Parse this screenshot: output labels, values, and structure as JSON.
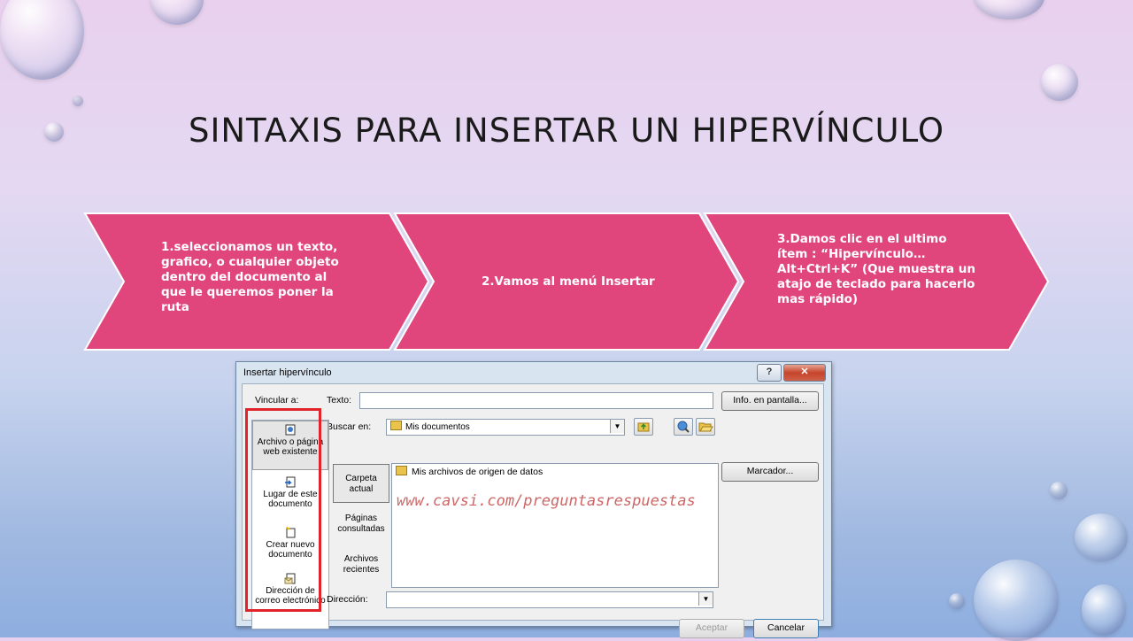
{
  "slide": {
    "title": "SINTAXIS PARA INSERTAR UN HIPERVÍNCULO"
  },
  "steps": [
    {
      "text": "1.seleccionamos un texto, grafico, o cualquier objeto dentro del documento al que le queremos poner la ruta"
    },
    {
      "text": "2.Vamos al menú Insertar"
    },
    {
      "text": "3.Damos clic en el ultimo ítem : “Hipervínculo…Alt+Ctrl+K” (Que muestra un atajo de teclado para hacerlo mas rápido)"
    }
  ],
  "colors": {
    "chevron": "#e0467c",
    "highlight_box": "#e1232c"
  },
  "dialog": {
    "title": "Insertar hipervínculo",
    "help_label": "?",
    "close_label": "✕",
    "link_to_label": "Vincular a:",
    "text_label": "Texto:",
    "text_value": "",
    "screentip_button": "Info. en pantalla...",
    "lookin_label": "Buscar en:",
    "lookin_value": "Mis documentos",
    "bookmark_button": "Marcador...",
    "sidebar": [
      {
        "label": "Archivo o página web existente",
        "icon": "file-web-icon"
      },
      {
        "label": "Lugar de este documento",
        "icon": "place-in-document-icon"
      },
      {
        "label": "Crear nuevo documento",
        "icon": "new-document-icon"
      },
      {
        "label": "Dirección de correo electrónico",
        "icon": "email-icon"
      }
    ],
    "lookin_tabs": [
      {
        "label": "Carpeta actual"
      },
      {
        "label": "Páginas consultadas"
      },
      {
        "label": "Archivos recientes"
      }
    ],
    "files": [
      {
        "name": "Mis archivos de origen de datos",
        "icon": "folder-icon"
      }
    ],
    "watermark": "www.cavsi.com/preguntasrespuestas",
    "address_label": "Dirección:",
    "address_value": "",
    "ok_button": "Aceptar",
    "cancel_button": "Cancelar"
  }
}
